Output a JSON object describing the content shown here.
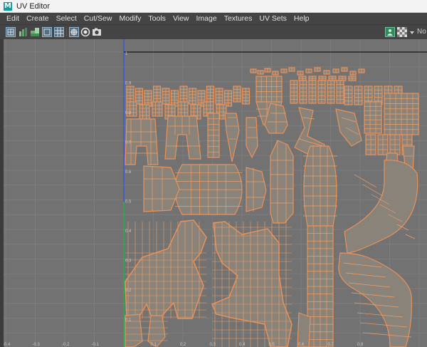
{
  "window": {
    "app_icon": "maya-m-logo",
    "app_icon_letter": "M",
    "title": "UV Editor"
  },
  "menu": [
    "Edit",
    "Create",
    "Select",
    "Cut/Sew",
    "Modify",
    "Tools",
    "View",
    "Image",
    "Textures",
    "UV Sets",
    "Help"
  ],
  "toolbar": {
    "left_icons": [
      "uv-shell-icon",
      "checker-bars-icon",
      "uv-grid-icon",
      "frame-icon",
      "grid-toggle-icon",
      "snap-icon",
      "camera-icon"
    ],
    "right_icons": [
      "image-icon",
      "checker-icon"
    ],
    "trailing_label": "No"
  },
  "viewport": {
    "u_ticks": [
      "-0.4",
      "-0.3",
      "-0.2",
      "-0.1",
      "0.1",
      "0.2",
      "0.3",
      "0.4",
      "0.5",
      "0.6",
      "0.7",
      "0.8"
    ],
    "v_ticks": [
      "1",
      "0.9",
      "0.8",
      "0.7",
      "0.6",
      "0.5",
      "0.4",
      "0.3",
      "0.2",
      "0.1"
    ],
    "colors": {
      "background": "#727272",
      "grid": "#7c7c7c",
      "u_axis": "#3a5cd6",
      "v_axis": "#21b24a",
      "uv_fill": "#8a8379",
      "uv_edge": "#f0a066",
      "uv_border": "#e9925a"
    }
  }
}
